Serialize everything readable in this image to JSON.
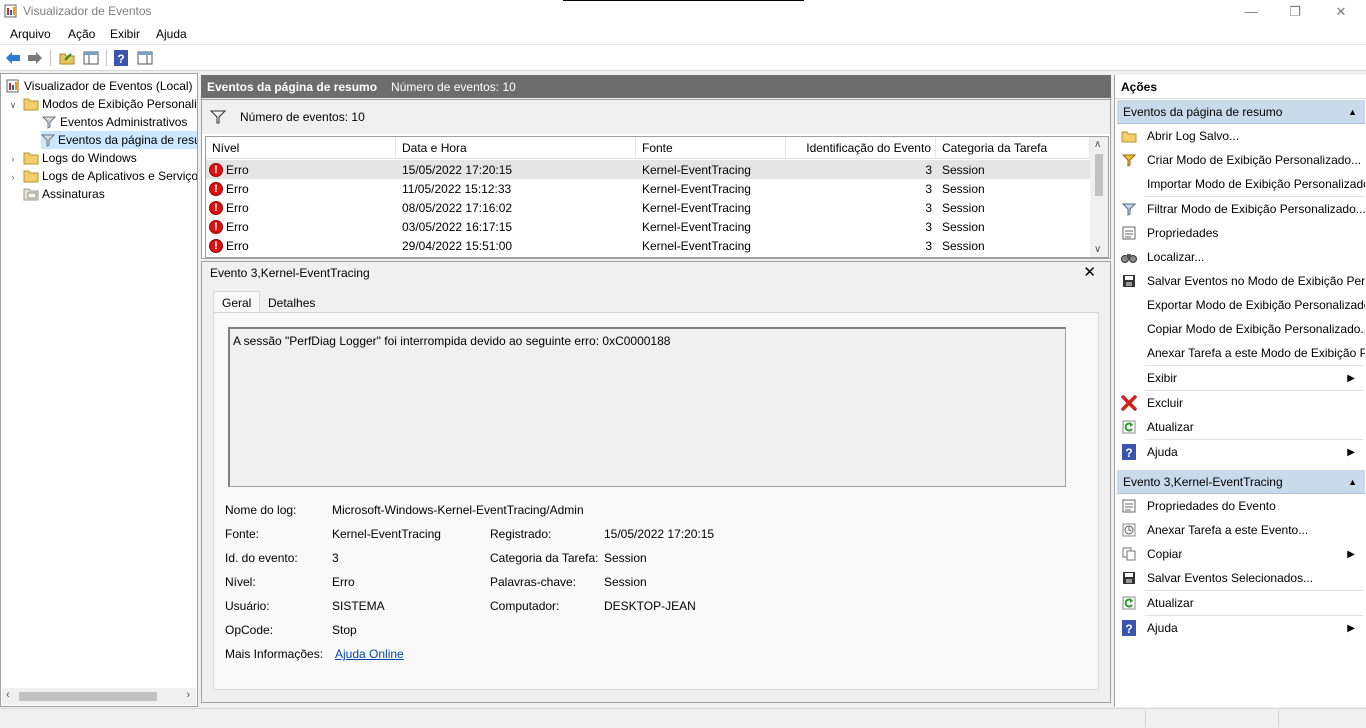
{
  "window": {
    "title": "Visualizador de Eventos"
  },
  "menu": [
    "Arquivo",
    "Ação",
    "Exibir",
    "Ajuda"
  ],
  "tree": {
    "root": "Visualizador de Eventos (Local)",
    "custom_views": "Modos de Exibição Personalizados",
    "admin_events": "Eventos Administrativos",
    "summary_events": "Eventos da página de resumo",
    "windows_logs": "Logs do Windows",
    "app_logs": "Logs de Aplicativos e Serviços",
    "subscriptions": "Assinaturas"
  },
  "center": {
    "header_title": "Eventos da página de resumo",
    "header_count": "Número de eventos: 10",
    "filter_text": "Número de eventos: 10",
    "columns": [
      "Nível",
      "Data e Hora",
      "Fonte",
      "Identificação do Evento",
      "Categoria da Tarefa"
    ],
    "rows": [
      {
        "level": "Erro",
        "date": "15/05/2022 17:20:15",
        "source": "Kernel-EventTracing",
        "id": "3",
        "category": "Session"
      },
      {
        "level": "Erro",
        "date": "11/05/2022 15:12:33",
        "source": "Kernel-EventTracing",
        "id": "3",
        "category": "Session"
      },
      {
        "level": "Erro",
        "date": "08/05/2022 17:16:02",
        "source": "Kernel-EventTracing",
        "id": "3",
        "category": "Session"
      },
      {
        "level": "Erro",
        "date": "03/05/2022 16:17:15",
        "source": "Kernel-EventTracing",
        "id": "3",
        "category": "Session"
      },
      {
        "level": "Erro",
        "date": "29/04/2022 15:51:00",
        "source": "Kernel-EventTracing",
        "id": "3",
        "category": "Session"
      }
    ]
  },
  "detail": {
    "title": "Evento 3,Kernel-EventTracing",
    "tab_general": "Geral",
    "tab_details": "Detalhes",
    "message": "A sessão \"PerfDiag Logger\" foi interrompida devido ao seguinte erro: 0xC0000188",
    "labels": {
      "log_name": "Nome do log:",
      "source": "Fonte:",
      "event_id": "Id. do evento:",
      "level": "Nível:",
      "user": "Usuário:",
      "opcode": "OpCode:",
      "more_info": "Mais Informações:",
      "logged": "Registrado:",
      "task_category": "Categoria da Tarefa:",
      "keywords": "Palavras-chave:",
      "computer": "Computador:"
    },
    "values": {
      "log_name": "Microsoft-Windows-Kernel-EventTracing/Admin",
      "source": "Kernel-EventTracing",
      "event_id": "3",
      "level": "Erro",
      "user": "SISTEMA",
      "opcode": "Stop",
      "more_info_link": "Ajuda Online",
      "logged": "15/05/2022 17:20:15",
      "task_category": "Session",
      "keywords": "Session",
      "computer": "DESKTOP-JEAN"
    }
  },
  "actions": {
    "title": "Ações",
    "section1": "Eventos da página de resumo",
    "items1": [
      "Abrir Log Salvo...",
      "Criar Modo de Exibição Personalizado...",
      "Importar Modo de Exibição Personalizado...",
      "Filtrar Modo de Exibição Personalizado...",
      "Propriedades",
      "Localizar...",
      "Salvar Eventos no Modo de Exibição Personalizado...",
      "Exportar Modo de Exibição Personalizado...",
      "Copiar Modo de Exibição Personalizado...",
      "Anexar Tarefa a este Modo de Exibição Personalizado...",
      "Exibir",
      "Excluir",
      "Atualizar",
      "Ajuda"
    ],
    "section2": "Evento 3,Kernel-EventTracing",
    "items2": [
      "Propriedades do Evento",
      "Anexar Tarefa a este Evento...",
      "Copiar",
      "Salvar Eventos Selecionados...",
      "Atualizar",
      "Ajuda"
    ]
  },
  "colors": {
    "accent_section": "#c9daea",
    "header_bar": "#6d6d6d",
    "selection": "#cce8ff",
    "error": "#dd1111"
  }
}
